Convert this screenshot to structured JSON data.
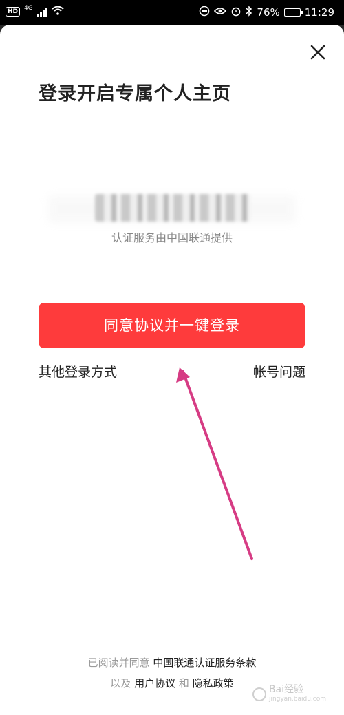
{
  "status_bar": {
    "hd": "HD",
    "network": "4G",
    "battery_text": "76%",
    "battery_level": 0.76,
    "time": "11:29",
    "icons": [
      "hd-icon",
      "signal-icon",
      "wifi-icon",
      "do-not-disturb-icon",
      "eye-icon",
      "alarm-icon",
      "bluetooth-icon",
      "battery-icon"
    ]
  },
  "login": {
    "title": "登录开启专属个人主页",
    "phone_masked": "186****7730",
    "provider_text": "认证服务由中国联通提供",
    "login_button": "同意协议并一键登录",
    "other_login": "其他登录方式",
    "account_issue": "帐号问题"
  },
  "agreement": {
    "prefix": "已阅读并同意",
    "service_terms": "中国联通认证服务条款",
    "and1": "以及",
    "user_agreement": "用户协议",
    "and2": "和",
    "privacy_policy": "隐私政策"
  },
  "watermark": {
    "text": "Bai经验",
    "url": "jingyan.baidu.com"
  },
  "colors": {
    "accent": "#fe3b3c",
    "annotation_arrow": "#d63c84",
    "secondary_text": "#888888"
  }
}
